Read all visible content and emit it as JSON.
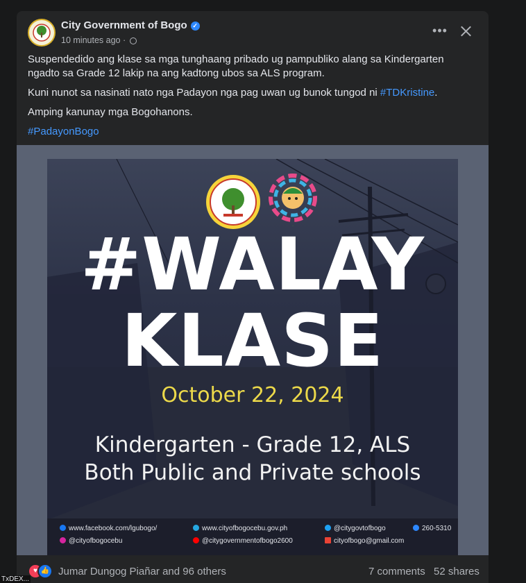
{
  "post": {
    "page_name": "City Government of Bogo",
    "time": "10 minutes ago",
    "separator": "·",
    "verified": true,
    "paragraphs": {
      "p1": "Suspendedido ang klase sa mga tunghaang pribado ug pampubliko alang sa Kindergarten ngadto sa Grade 12 lakip na ang kadtong ubos sa ALS program.",
      "p2_text": "Kuni nunot sa nasinati nato nga Padayon nga pag uwan ug bunok tungod ni ",
      "p2_hashtag": "#TDKristine",
      "p2_end": ".",
      "p3": "Amping kanunay mga Bogohanons.",
      "p4_hashtag": "#PadayonBogo"
    }
  },
  "poster": {
    "logo_bogo_text_top": "CITY OF BOGO",
    "logo_bogo_text_bottom": "CEBU",
    "logo_bogo_year": "2007",
    "line1": "#WALAY",
    "line2": "KLASE",
    "date": "October 22, 2024",
    "levels_line1": "Kindergarten - Grade 12, ALS",
    "levels_line2": "Both Public and Private schools",
    "contacts": {
      "facebook": "www.facebook.com/lgubogo/",
      "website": "www.cityofbogocebu.gov.ph",
      "twitter": "@citygovtofbogo",
      "phone": "260-5310",
      "instagram": "@cityofbogocebu",
      "youtube": "@citygovernmentofbogo2600",
      "email": "cityofbogo@gmail.com"
    }
  },
  "footer": {
    "reactions_text": "Jumar Dungog Piañar and 96 others",
    "comments": "7 comments",
    "shares": "52 shares"
  },
  "taskbar": {
    "text": "TxDEX..."
  },
  "colors": {
    "background": "#18191a",
    "card": "#242526",
    "hashtag": "#4599ff",
    "verified": "#2d88ff",
    "poster_date": "#ecd94a"
  }
}
